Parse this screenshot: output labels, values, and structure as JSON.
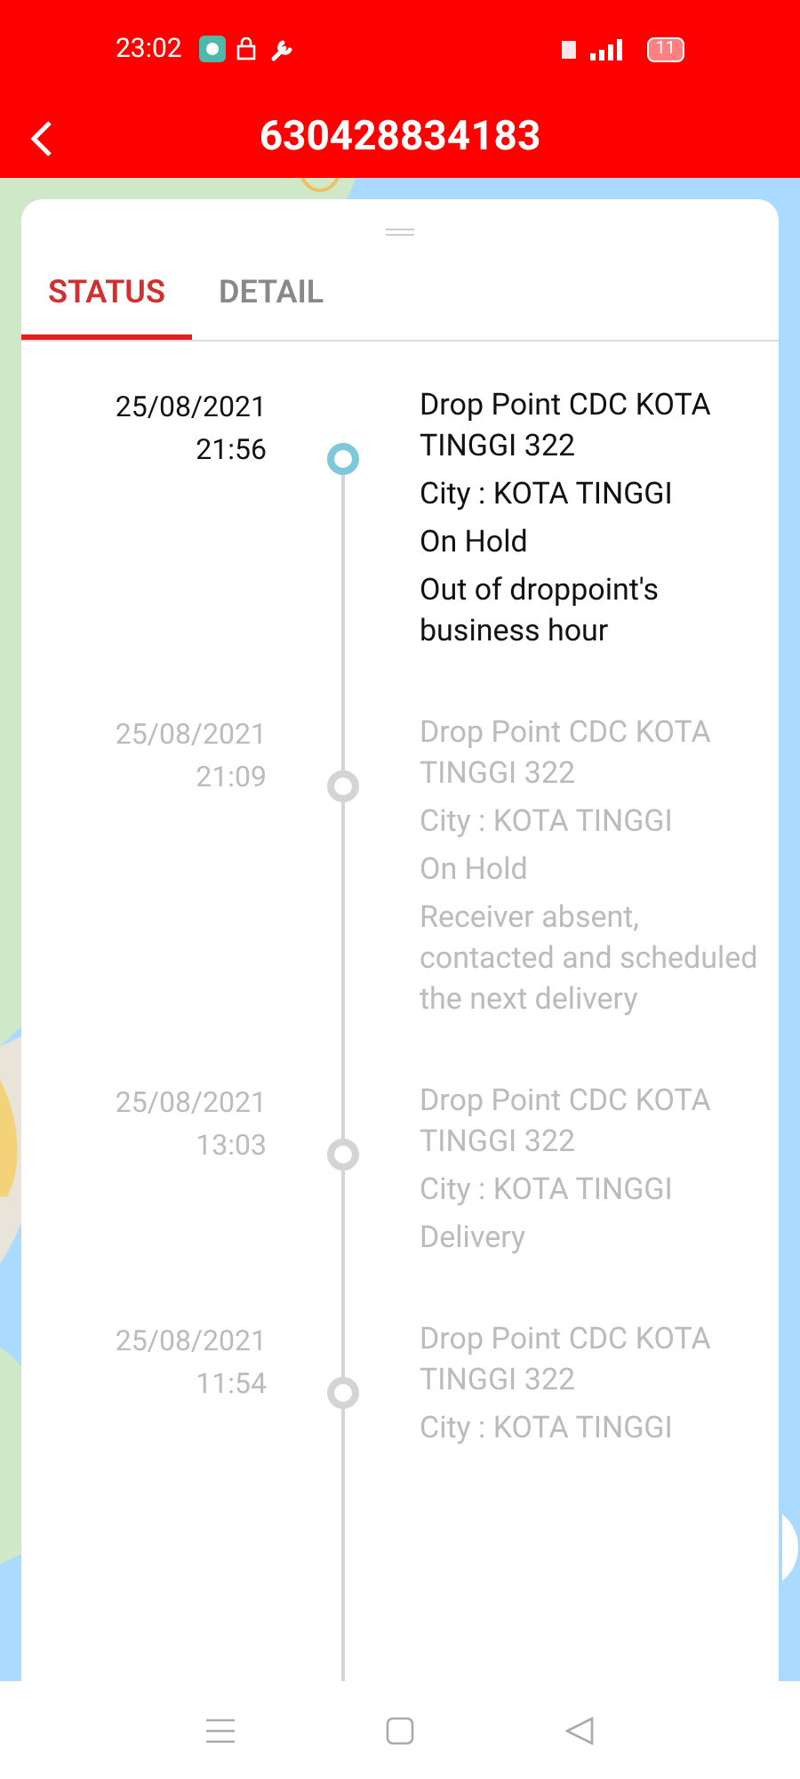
{
  "status_bar": {
    "time": "23:02",
    "battery": "11"
  },
  "header": {
    "title": "630428834183"
  },
  "tabs": [
    {
      "label": "STATUS",
      "selected": true
    },
    {
      "label": "DETAIL",
      "selected": false
    }
  ],
  "events": [
    {
      "date": "25/08/2021",
      "time": "21:56",
      "current": true,
      "lines": [
        "Drop Point CDC KOTA TINGGI 322",
        "City : KOTA TINGGI",
        "On Hold",
        "Out of droppoint's business hour"
      ]
    },
    {
      "date": "25/08/2021",
      "time": "21:09",
      "current": false,
      "lines": [
        "Drop Point CDC KOTA TINGGI 322",
        "City : KOTA TINGGI",
        "On Hold",
        "Receiver absent, contacted and scheduled the next delivery"
      ]
    },
    {
      "date": "25/08/2021",
      "time": "13:03",
      "current": false,
      "lines": [
        "Drop Point CDC KOTA TINGGI 322",
        "City : KOTA TINGGI",
        "Delivery"
      ]
    },
    {
      "date": "25/08/2021",
      "time": "11:54",
      "current": false,
      "lines": [
        "Drop Point CDC KOTA TINGGI 322",
        "City : KOTA TINGGI"
      ]
    }
  ]
}
